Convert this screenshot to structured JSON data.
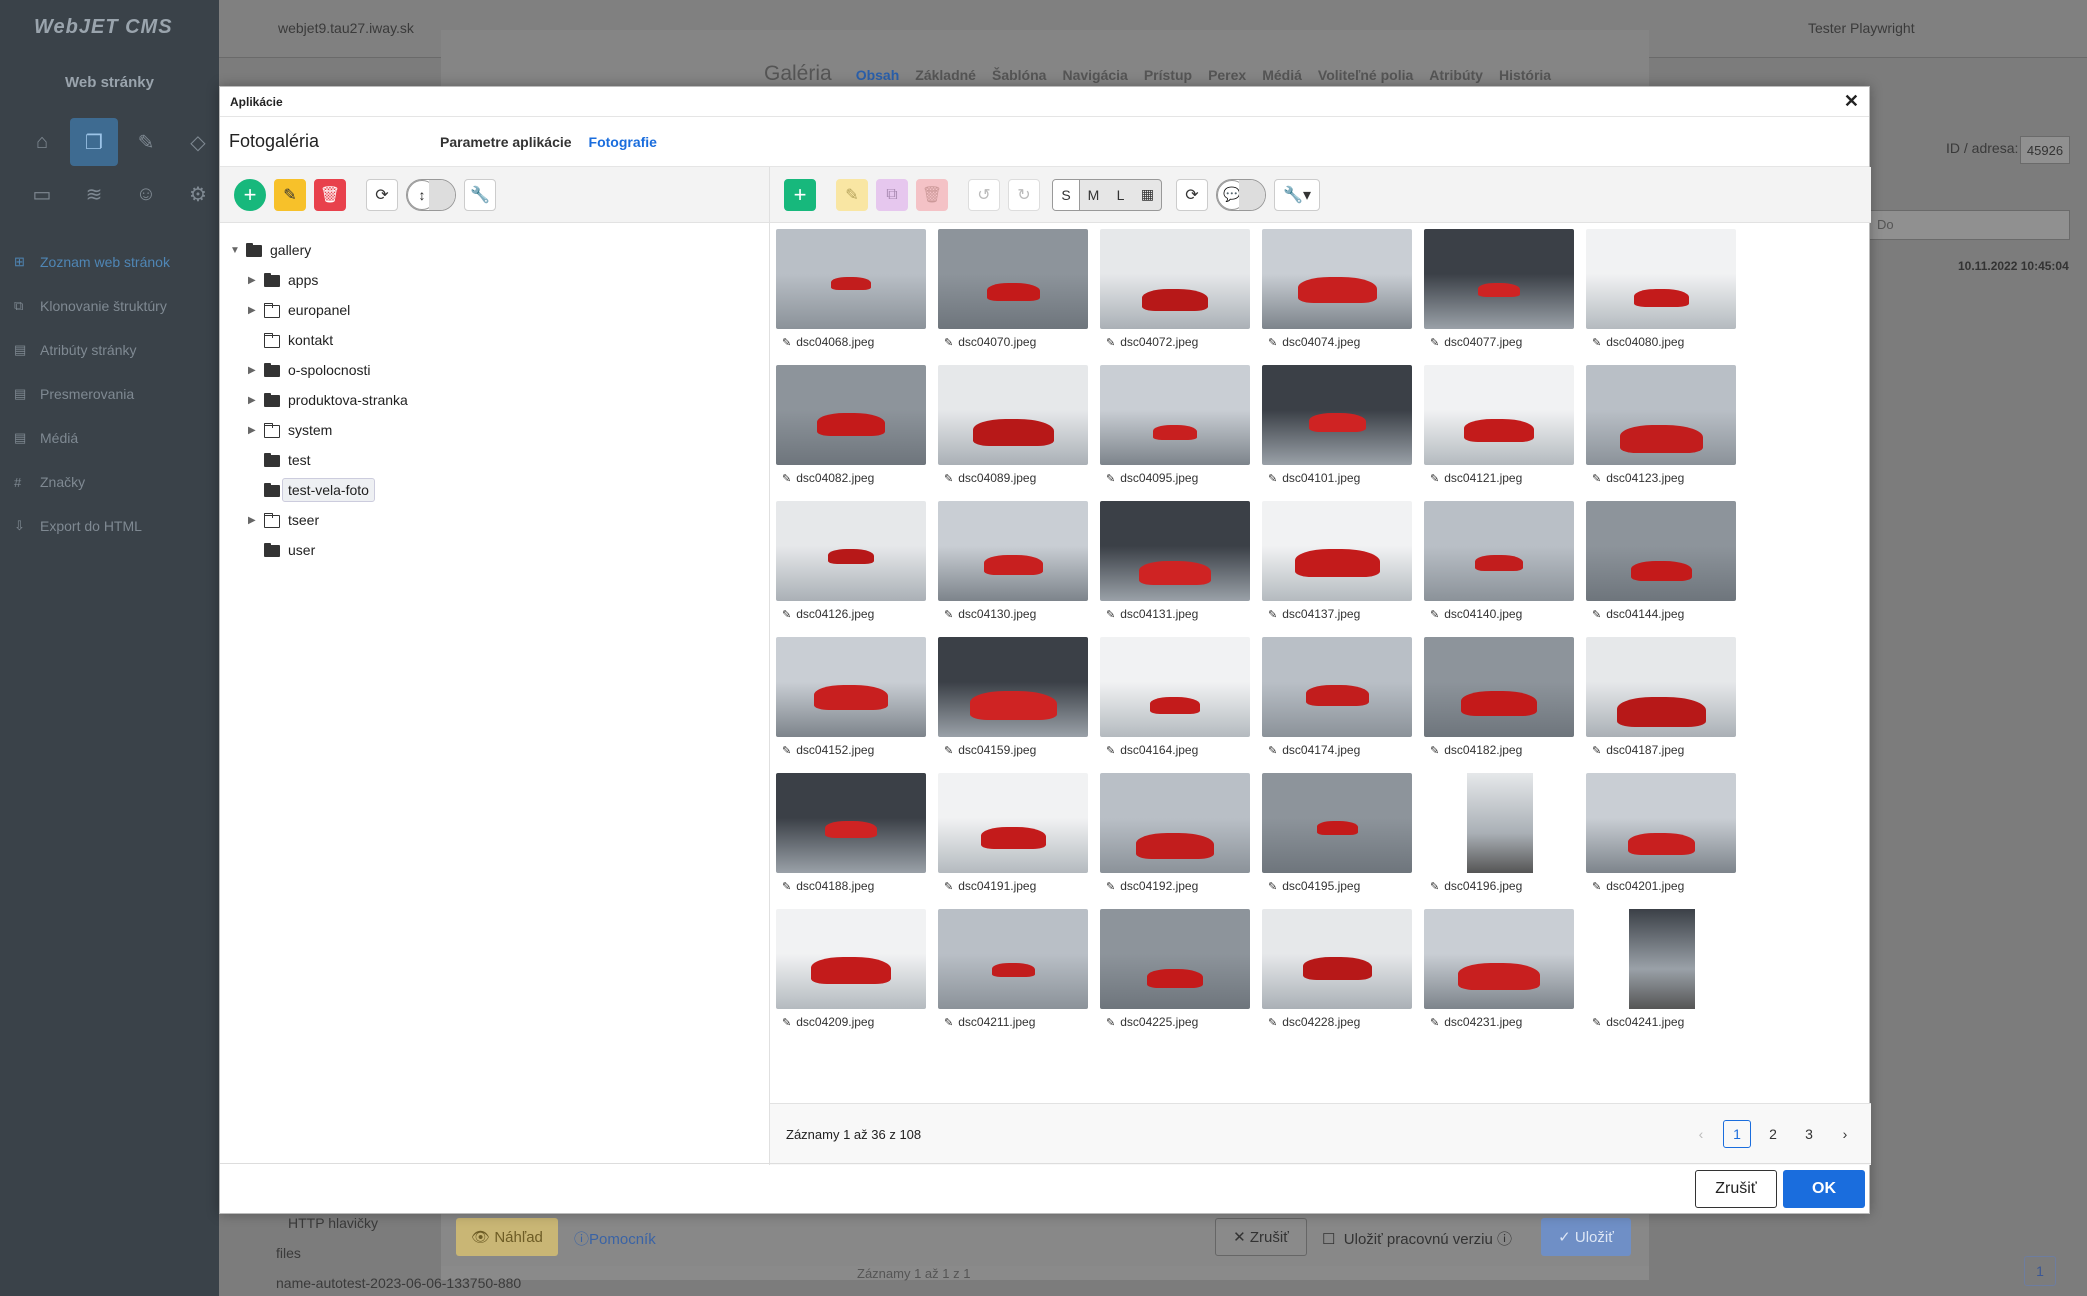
{
  "app": {
    "logo": "WebJET CMS",
    "url": "webjet9.tau27.iway.sk",
    "user": "Tester Playwright",
    "section_title": "Web stránky"
  },
  "sidebar": {
    "items": [
      {
        "label": "Zoznam web stránok",
        "icon": "tree-icon"
      },
      {
        "label": "Klonovanie štruktúry",
        "icon": "copy-icon"
      },
      {
        "label": "Atribúty stránky",
        "icon": "doc-icon"
      },
      {
        "label": "Presmerovania",
        "icon": "redirect-icon"
      },
      {
        "label": "Médiá",
        "icon": "media-icon"
      },
      {
        "label": "Značky",
        "icon": "hash-icon"
      },
      {
        "label": "Export do HTML",
        "icon": "export-icon"
      }
    ]
  },
  "editor": {
    "big_tab": "Galéria",
    "tabs": [
      "Obsah",
      "Základné",
      "Šablóna",
      "Navigácia",
      "Prístup",
      "Perex",
      "Médiá",
      "Voliteľné polia",
      "Atribúty",
      "História"
    ],
    "active_tab": "Obsah",
    "id_label": "ID / adresa:",
    "id_value": "45926",
    "date": "10.11.2022 10:45:04",
    "do_placeholder": "Do",
    "bottom_tree": [
      "HTTP hlavičky",
      "files",
      "name-autotest-2023-06-06-133750-880"
    ],
    "zaznamy": "Záznamy 1 až 1 z 1",
    "btn_preview": "Náhľad",
    "btn_helper": "Pomocník",
    "btn_cancel": "Zrušiť",
    "chk_work": "Uložiť pracovnú verziu",
    "btn_save": "Uložiť",
    "page_btn": "1"
  },
  "modal": {
    "header": "Aplikácie",
    "app_title": "Fotogaléria",
    "tabs": [
      "Parametre aplikácie",
      "Fotografie"
    ],
    "active_tab": "Fotografie",
    "tree": [
      {
        "label": "gallery",
        "level": 0,
        "caret": "▼",
        "folder": "solid"
      },
      {
        "label": "apps",
        "level": 1,
        "caret": "▶",
        "folder": "solid"
      },
      {
        "label": "europanel",
        "level": 1,
        "caret": "▶",
        "folder": "open"
      },
      {
        "label": "kontakt",
        "level": 1,
        "caret": "",
        "folder": "open"
      },
      {
        "label": "o-spolocnosti",
        "level": 1,
        "caret": "▶",
        "folder": "solid"
      },
      {
        "label": "produktova-stranka",
        "level": 1,
        "caret": "▶",
        "folder": "solid"
      },
      {
        "label": "system",
        "level": 1,
        "caret": "▶",
        "folder": "open"
      },
      {
        "label": "test",
        "level": 1,
        "caret": "",
        "folder": "solid"
      },
      {
        "label": "test-vela-foto",
        "level": 1,
        "caret": "",
        "folder": "solid",
        "selected": true
      },
      {
        "label": "tseer",
        "level": 1,
        "caret": "▶",
        "folder": "open"
      },
      {
        "label": "user",
        "level": 1,
        "caret": "",
        "folder": "solid"
      }
    ],
    "size_options": [
      "S",
      "M",
      "L"
    ],
    "size_selected": "S",
    "images": [
      "dsc04068.jpeg",
      "dsc04070.jpeg",
      "dsc04072.jpeg",
      "dsc04074.jpeg",
      "dsc04077.jpeg",
      "dsc04080.jpeg",
      "dsc04082.jpeg",
      "dsc04089.jpeg",
      "dsc04095.jpeg",
      "dsc04101.jpeg",
      "dsc04121.jpeg",
      "dsc04123.jpeg",
      "dsc04126.jpeg",
      "dsc04130.jpeg",
      "dsc04131.jpeg",
      "dsc04137.jpeg",
      "dsc04140.jpeg",
      "dsc04144.jpeg",
      "dsc04152.jpeg",
      "dsc04159.jpeg",
      "dsc04164.jpeg",
      "dsc04174.jpeg",
      "dsc04182.jpeg",
      "dsc04187.jpeg",
      "dsc04188.jpeg",
      "dsc04191.jpeg",
      "dsc04192.jpeg",
      "dsc04195.jpeg",
      "dsc04196.jpeg",
      "dsc04201.jpeg",
      "dsc04209.jpeg",
      "dsc04211.jpeg",
      "dsc04225.jpeg",
      "dsc04228.jpeg",
      "dsc04231.jpeg",
      "dsc04241.jpeg"
    ],
    "records": "Záznamy 1 až 36 z 108",
    "pages": [
      "1",
      "2",
      "3"
    ],
    "current_page": "1",
    "btn_cancel": "Zrušiť",
    "btn_ok": "OK"
  },
  "colors": {
    "accent": "#1a6ddd",
    "green": "#17b87c",
    "yellow": "#f7c12a",
    "red": "#e8414c"
  }
}
